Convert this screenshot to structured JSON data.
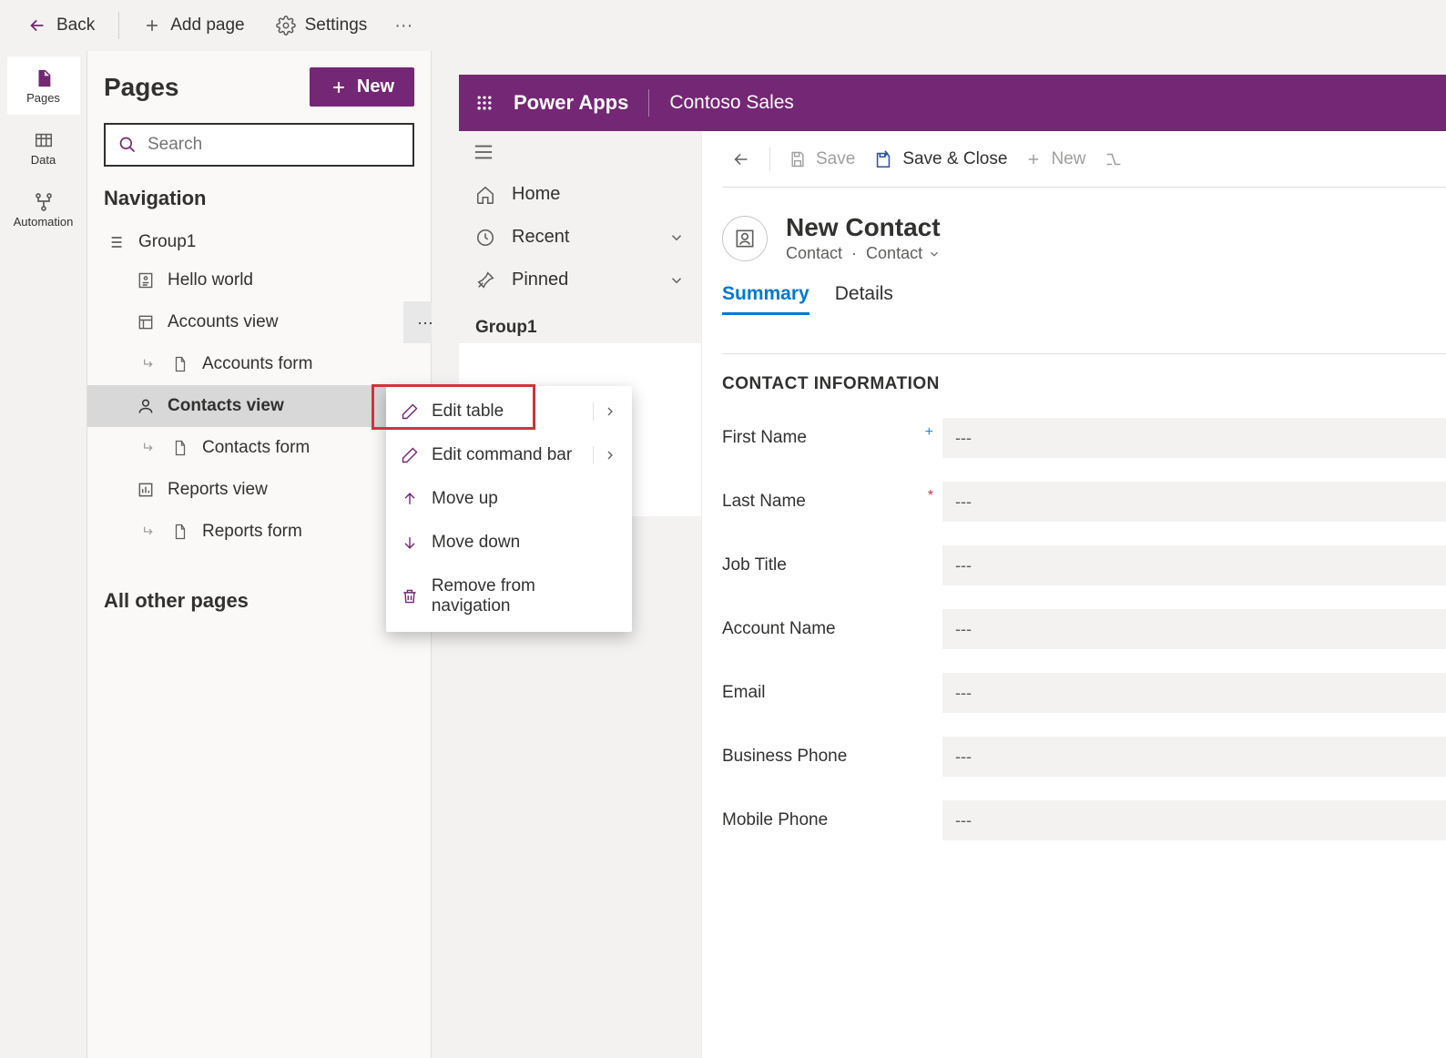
{
  "toolbar": {
    "back": "Back",
    "add_page": "Add page",
    "settings": "Settings"
  },
  "left_rail": {
    "pages": "Pages",
    "data": "Data",
    "automation": "Automation"
  },
  "panel": {
    "title": "Pages",
    "new_btn": "New",
    "search_placeholder": "Search",
    "nav_title": "Navigation",
    "group_label": "Group1",
    "items": {
      "hello": "Hello world",
      "accounts_view": "Accounts view",
      "accounts_form": "Accounts form",
      "contacts_view": "Contacts view",
      "contacts_form": "Contacts form",
      "reports_view": "Reports view",
      "reports_form": "Reports form"
    },
    "all_other": "All other pages"
  },
  "context_menu": {
    "edit_table": "Edit table",
    "edit_command_bar": "Edit command bar",
    "move_up": "Move up",
    "move_down": "Move down",
    "remove": "Remove from navigation"
  },
  "preview": {
    "brand": "Power Apps",
    "app_name": "Contoso Sales",
    "sitemap": {
      "home": "Home",
      "recent": "Recent",
      "pinned": "Pinned",
      "group": "Group1"
    },
    "cmdbar": {
      "save": "Save",
      "save_close": "Save & Close",
      "new": "New"
    },
    "record": {
      "title": "New Contact",
      "entity": "Contact",
      "form": "Contact"
    },
    "tabs": {
      "summary": "Summary",
      "details": "Details"
    },
    "section_title": "CONTACT INFORMATION",
    "placeholder": "---",
    "fields": {
      "first_name": "First Name",
      "last_name": "Last Name",
      "job_title": "Job Title",
      "account_name": "Account Name",
      "email": "Email",
      "business_phone": "Business Phone",
      "mobile_phone": "Mobile Phone"
    }
  }
}
